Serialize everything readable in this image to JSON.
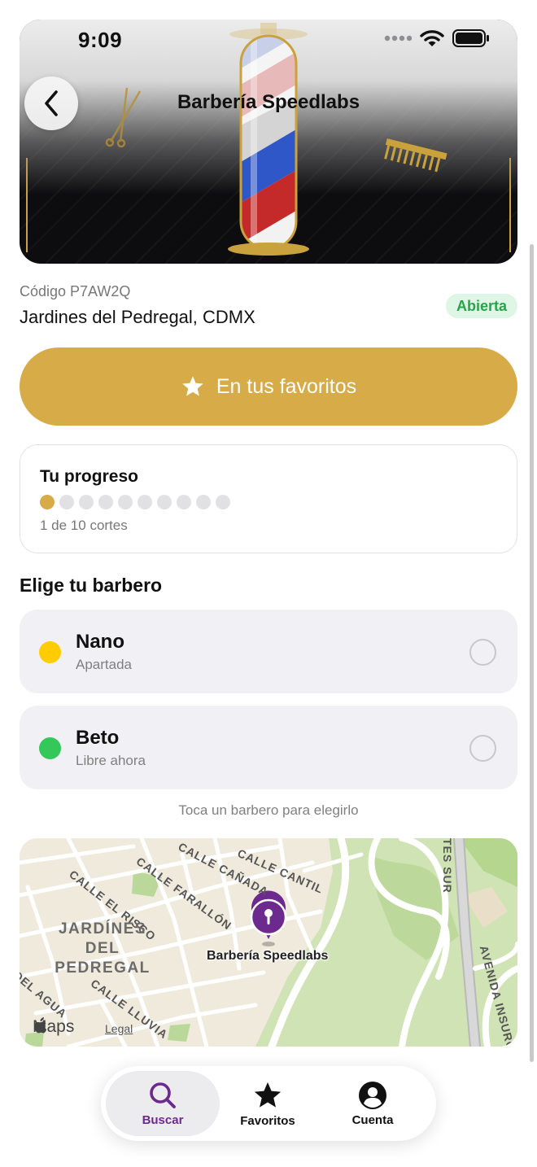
{
  "status_bar": {
    "time": "9:09"
  },
  "header": {
    "title": "Barbería Speedlabs",
    "back_icon": "chevron-left-icon"
  },
  "shop": {
    "code": "Código P7AW2Q",
    "address": "Jardines del Pedregal, CDMX",
    "status": "Abierta",
    "favorite_label": "En tus favoritos"
  },
  "progress": {
    "title": "Tu progreso",
    "completed": 1,
    "total": 10,
    "text": "1 de 10 cortes"
  },
  "barbers": {
    "title": "Elige tu barbero",
    "items": [
      {
        "name": "Nano",
        "status": "Apartada",
        "color": "#ffcc00"
      },
      {
        "name": "Beto",
        "status": "Libre ahora",
        "color": "#34c759"
      }
    ],
    "hint": "Toca un barbero para elegirlo"
  },
  "map": {
    "district": "JARDÍNES DEL PEDREGAL",
    "pin_label": "Barbería Speedlabs",
    "streets": [
      "CALLE CAÑADA",
      "CALLE CANTIL",
      "CALLE EL RISCO",
      "CALLE FARALLÓN",
      "DEL AGUA",
      "CALLE LLUVIA",
      "TES SUR",
      "AVENIDA INSURG"
    ],
    "attribution": "Maps",
    "legal": "Legal"
  },
  "tabs": [
    {
      "label": "Buscar",
      "icon": "search-icon",
      "active": true
    },
    {
      "label": "Favoritos",
      "icon": "star-icon",
      "active": false
    },
    {
      "label": "Cuenta",
      "icon": "account-icon",
      "active": false
    }
  ],
  "colors": {
    "accent": "#d6ab48",
    "open": "#27a44a",
    "tab_active": "#6c2a8f"
  }
}
